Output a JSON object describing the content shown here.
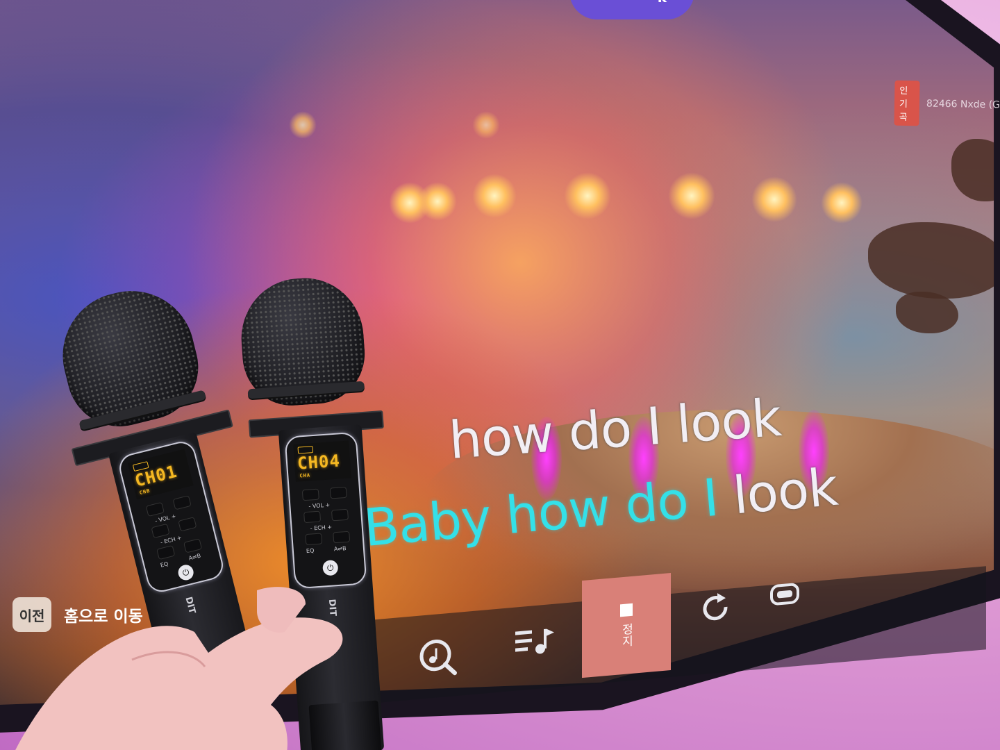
{
  "tv": {
    "top_pill_text": "k",
    "song_badge": "인기곡",
    "song_title": "82466 Nxde (G",
    "lyrics": {
      "line1": "how do I look",
      "line2_sung": "Baby how do I",
      "line2_rest": " look"
    },
    "nav": {
      "back_key": "이전",
      "back_text": "홈으로 이동"
    },
    "toolbar": {
      "stop_label": "정지",
      "icons": [
        "music-search-icon",
        "playlist-icon",
        "stop-icon",
        "replay-icon",
        "voice-icon"
      ]
    }
  },
  "microphones": [
    {
      "channel": "CH01",
      "sub": "CHB",
      "brand": "DIT",
      "buttons": [
        "- VOL +",
        "- ECH +",
        "EQ",
        "A⇌B"
      ]
    },
    {
      "channel": "CH04",
      "sub": "CHA",
      "brand": "DIT",
      "buttons": [
        "- VOL +",
        "- ECH +",
        "EQ",
        "A⇌B"
      ]
    }
  ],
  "colors": {
    "sung_lyric": "#34e0e8",
    "unsung_lyric": "#f2eef4",
    "lcd": "#f5b822",
    "stop_button": "#d98078",
    "badge": "#d9544a"
  }
}
